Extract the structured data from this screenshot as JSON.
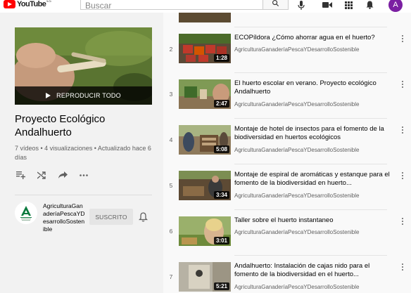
{
  "header": {
    "logo_text": "YouTube",
    "country_code": "ES",
    "search_placeholder": "Buscar",
    "avatar_letter": "A",
    "icons": [
      "search-icon",
      "microphone-icon",
      "create-video-icon",
      "apps-icon",
      "notifications-icon"
    ]
  },
  "playlist": {
    "play_all_label": "REPRODUCIR TODO",
    "title": "Proyecto Ecológico Andalhuerto",
    "stats": "7 vídeos • 4 visualizaciones • Actualizado hace 6 días",
    "actions": [
      "add-to-queue-icon",
      "shuffle-icon",
      "share-icon",
      "more-icon"
    ],
    "owner": {
      "name": "AgriculturaGanaderíaPescaYDesarrolloSostenible",
      "subscribe_label": "SUSCRITO"
    }
  },
  "videos": [
    {
      "index": "",
      "title": "",
      "channel": "",
      "duration": ""
    },
    {
      "index": "2",
      "title": "ECOPíldora ¿Cómo ahorrar agua en el huerto?",
      "channel": "AgriculturaGanaderíaPescaYDesarrolloSostenible",
      "duration": "1:28"
    },
    {
      "index": "3",
      "title": "El huerto escolar en verano. Proyecto ecológico Andalhuerto",
      "channel": "AgriculturaGanaderíaPescaYDesarrolloSostenible",
      "duration": "2:47"
    },
    {
      "index": "4",
      "title": "Montaje de hotel de insectos para el fomento de la biodiversidad en huertos ecológicos",
      "channel": "AgriculturaGanaderíaPescaYDesarrolloSostenible",
      "duration": "5:08"
    },
    {
      "index": "5",
      "title": "Montaje de espiral de aromáticas y estanque para el fomento de la biodiversidad en huerto...",
      "channel": "AgriculturaGanaderíaPescaYDesarrolloSostenible",
      "duration": "3:34"
    },
    {
      "index": "6",
      "title": "Taller sobre el huerto instantaneo",
      "channel": "AgriculturaGanaderíaPescaYDesarrolloSostenible",
      "duration": "3:01"
    },
    {
      "index": "7",
      "title": "Andalhuerto: Instalación de cajas nido para el fomento de la biodiversidad en el huerto...",
      "channel": "AgriculturaGanaderíaPescaYDesarrolloSostenible",
      "duration": "5:21"
    }
  ],
  "colors": {
    "brand_red": "#ff0000",
    "avatar_bg": "#7b1fa2",
    "sidebar_bg": "#f2f2f2",
    "subscribed_bg": "#e5e5e5"
  }
}
